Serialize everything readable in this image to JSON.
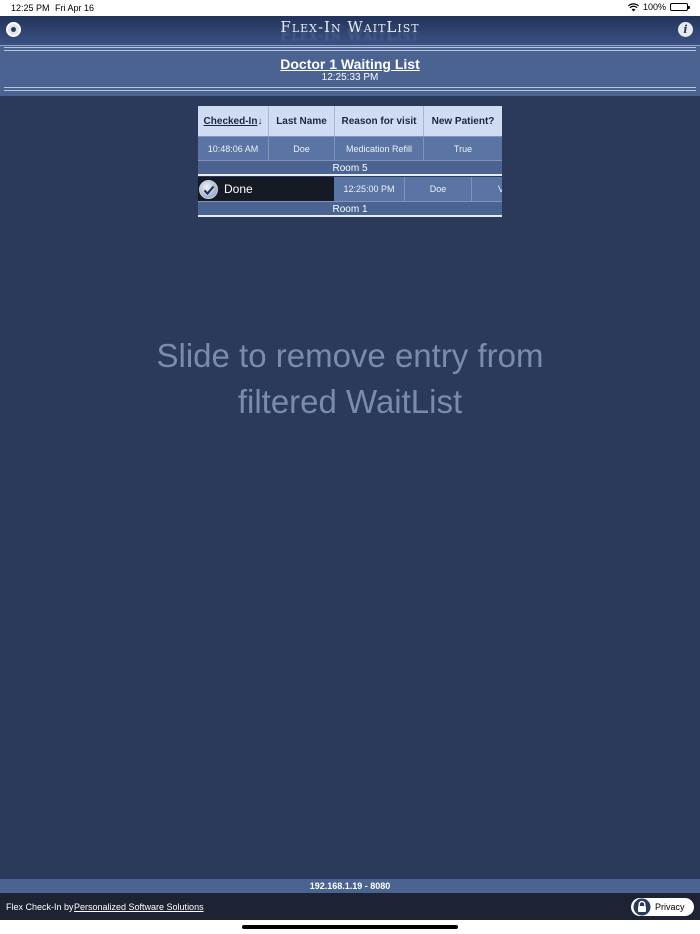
{
  "status_bar": {
    "time": "12:25 PM",
    "date": "Fri Apr 16",
    "battery": "100%"
  },
  "app": {
    "logo": "Flex-In WaitList",
    "settings_icon": "settings-icon",
    "info_icon": "info-icon",
    "info_glyph": "i"
  },
  "header": {
    "title": "Doctor 1 Waiting List",
    "time": "12:25:33 PM"
  },
  "table": {
    "columns": [
      "Checked-In",
      "Last Name",
      "Reason for visit",
      "New Patient?"
    ],
    "sort_arrow": "↓",
    "rows": [
      {
        "checked_in": "10:48:06 AM",
        "last_name": "Doe",
        "reason": "Medication Refill",
        "new_patient": "True",
        "room": "Room 5"
      },
      {
        "checked_in": "12:25:00 PM",
        "last_name": "Doe",
        "reason_partial": "V",
        "room": "Room 1",
        "swipe_action": "Done"
      }
    ]
  },
  "hint": {
    "line1": "Slide to remove entry from",
    "line2": "filtered WaitList"
  },
  "footer": {
    "server": "192.168.1.19 - 8080",
    "by_text": "Flex Check-In by",
    "link": "Personalized Software Solutions",
    "privacy": "Privacy"
  },
  "colors": {
    "background": "#2b3a5a",
    "header_band": "#4a6391",
    "table_header": "#cfdcf3",
    "row": "#5a74a3",
    "footer": "#1d2333"
  }
}
